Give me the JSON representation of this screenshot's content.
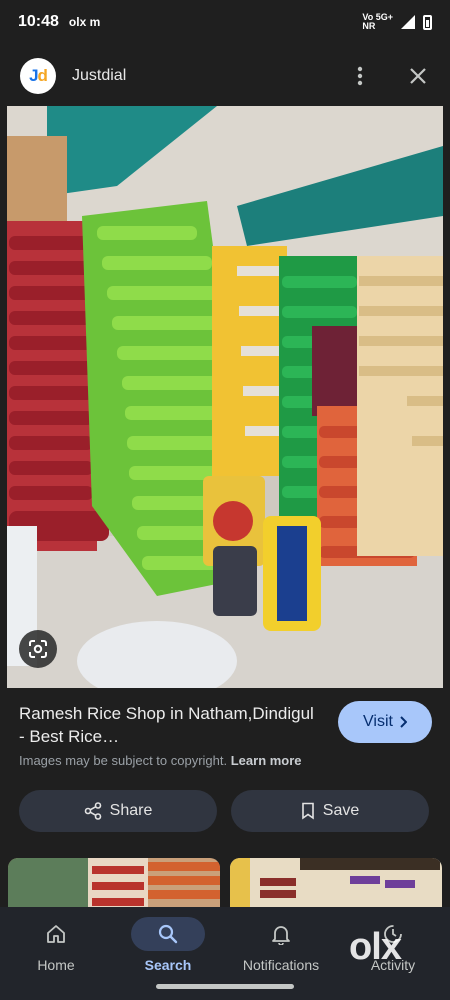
{
  "status_bar": {
    "time": "10:48",
    "extra": "olx m",
    "net_top": "Vo 5G+",
    "net_bottom": "NR"
  },
  "header": {
    "logo_text_j": "J",
    "logo_text_d": "d",
    "site_name": "Justdial",
    "more_icon": "more-vert-icon",
    "close_icon": "close-icon"
  },
  "image": {
    "description_icon": "google-lens-icon"
  },
  "result": {
    "title": "Ramesh Rice Shop in Natham,Dindigul - Best Rice…",
    "copyright_text": "Images may be subject to copyright.",
    "learn_more": "Learn more",
    "visit_label": "Visit"
  },
  "actions": {
    "share_label": "Share",
    "save_label": "Save"
  },
  "bottom_nav": {
    "items": [
      {
        "label": "Home",
        "icon": "home-icon",
        "active": false
      },
      {
        "label": "Search",
        "icon": "search-icon",
        "active": true
      },
      {
        "label": "Notifications",
        "icon": "bell-icon",
        "active": false
      },
      {
        "label": "Activity",
        "icon": "activity-icon",
        "active": false
      }
    ]
  },
  "watermark": "olx",
  "colors": {
    "accent": "#a8c7fa",
    "background": "#1f1f1f",
    "pill": "#303540"
  }
}
